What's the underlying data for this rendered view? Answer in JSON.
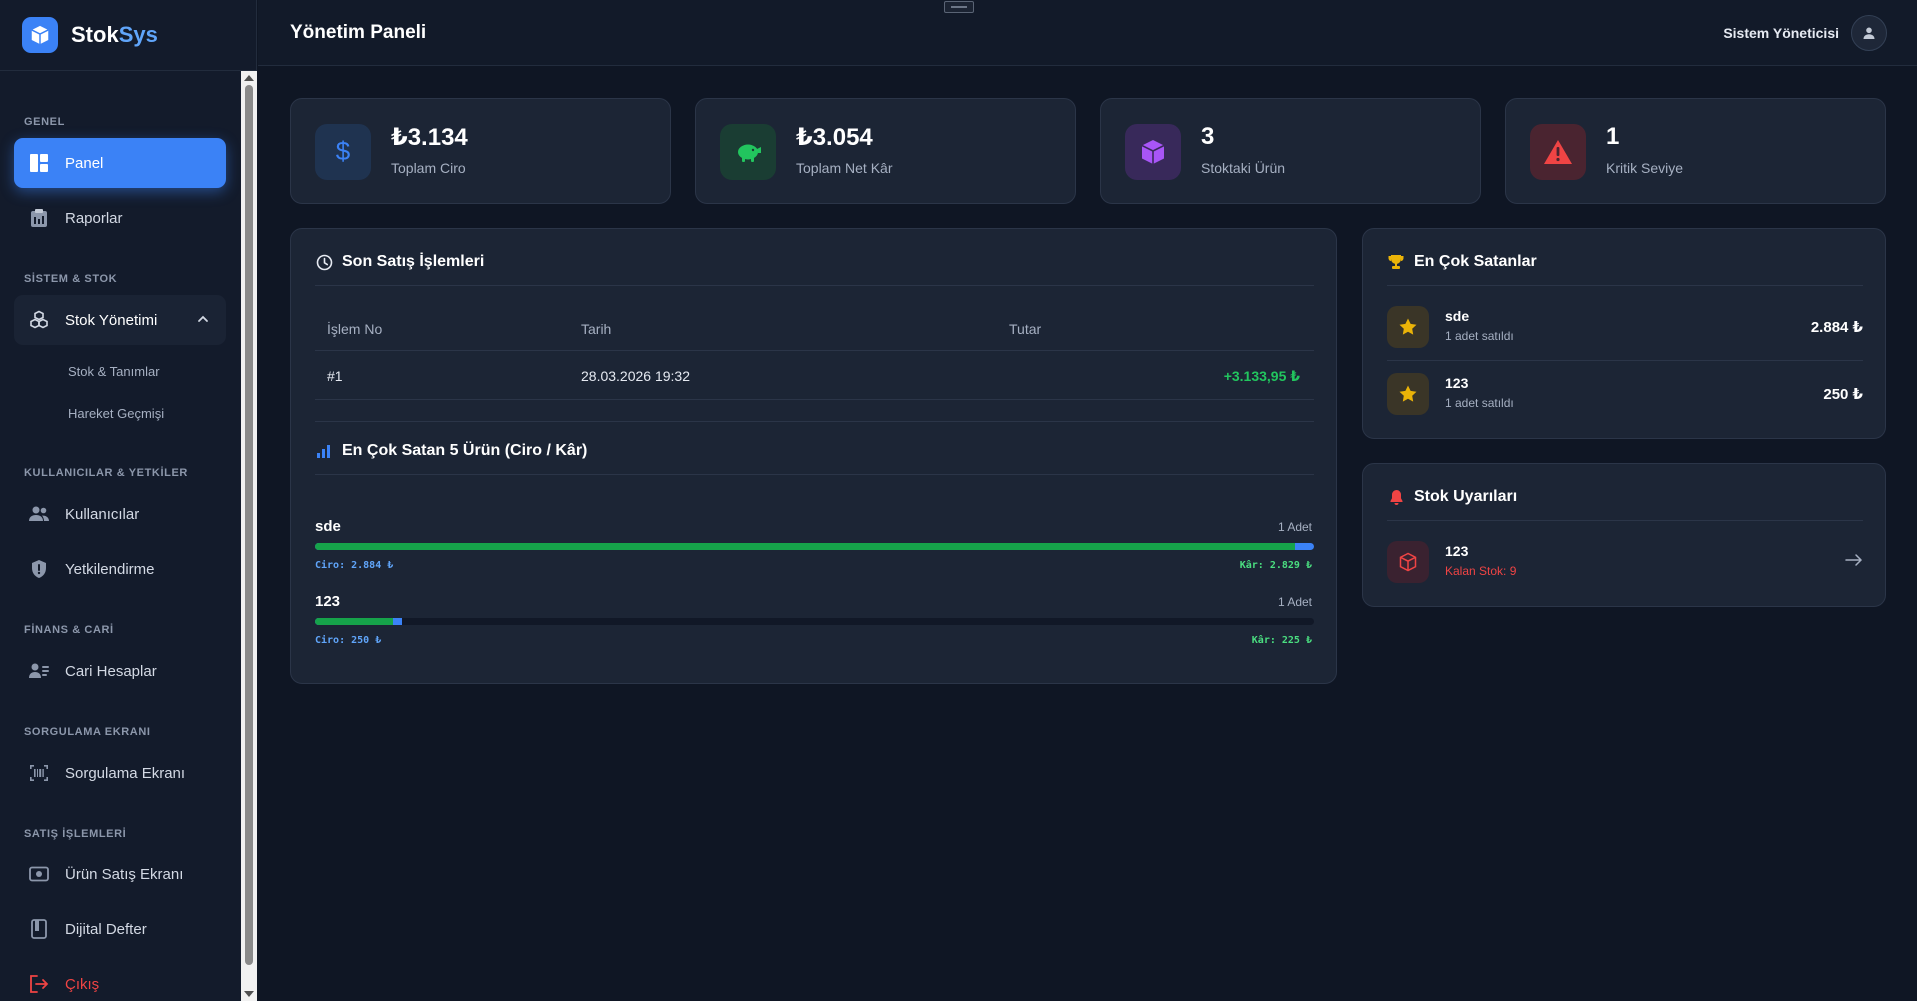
{
  "brand": {
    "name_main": "Stok",
    "name_accent": "Sys",
    "icon": "box-icon"
  },
  "colors": {
    "accent": "#3b82f6",
    "success": "#22c55e",
    "danger": "#ef4444",
    "purple": "#a855f7",
    "warning": "#eab308",
    "background": "#0f1624",
    "card": "#1c2535"
  },
  "sidebar": {
    "sections": {
      "genel": "GENEL",
      "sistem_stok": "SİSTEM & STOK",
      "kullanicilar": "KULLANICILAR & YETKİLER",
      "finans": "FİNANS & CARİ",
      "sorgulama": "SORGULAMA EKRANI",
      "satis": "SATIŞ İŞLEMLERİ"
    },
    "items": {
      "panel": "Panel",
      "raporlar": "Raporlar",
      "stok_yonetimi": "Stok Yönetimi",
      "stok_tanimlar": "Stok & Tanımlar",
      "hareket_gecmisi": "Hareket Geçmişi",
      "kullanicilar": "Kullanıcılar",
      "yetkilendirme": "Yetkilendirme",
      "cari_hesaplar": "Cari Hesaplar",
      "sorgulama_ekrani": "Sorgulama Ekranı",
      "urun_satis_ekrani": "Ürün Satış Ekranı",
      "dijital_defter": "Dijital Defter",
      "cikis": "Çıkış"
    }
  },
  "header": {
    "title": "Yönetim Paneli",
    "user_name": "Sistem Yöneticisi"
  },
  "stats": [
    {
      "value": "₺3.134",
      "label": "Toplam Ciro",
      "icon": "dollar-icon"
    },
    {
      "value": "₺3.054",
      "label": "Toplam Net Kâr",
      "icon": "piggy-bank-icon"
    },
    {
      "value": "3",
      "label": "Stoktaki Ürün",
      "icon": "cube-icon"
    },
    {
      "value": "1",
      "label": "Kritik Seviye",
      "icon": "warning-icon"
    }
  ],
  "recent_sales": {
    "title": "Son Satış İşlemleri",
    "columns": [
      "İşlem No",
      "Tarih",
      "Tutar"
    ],
    "rows": [
      {
        "no": "#1",
        "date": "28.03.2026 19:32",
        "amount": "+3.133,95 ₺"
      }
    ]
  },
  "top_products_chart": {
    "title": "En Çok Satan 5 Ürün (Ciro / Kâr)",
    "items": [
      {
        "name": "sde",
        "qty": "1 Adet",
        "ciro_label": "Ciro: 2.884 ₺",
        "kar_label": "Kâr: 2.829 ₺",
        "ciro": 2884,
        "kar": 2829
      },
      {
        "name": "123",
        "qty": "1 Adet",
        "ciro_label": "Ciro: 250 ₺",
        "kar_label": "Kâr: 225 ₺",
        "ciro": 250,
        "kar": 225
      }
    ]
  },
  "best_sellers": {
    "title": "En Çok Satanlar",
    "items": [
      {
        "name": "sde",
        "sub": "1 adet satıldı",
        "value": "2.884 ₺"
      },
      {
        "name": "123",
        "sub": "1 adet satıldı",
        "value": "250 ₺"
      }
    ]
  },
  "stock_alerts": {
    "title": "Stok Uyarıları",
    "items": [
      {
        "name": "123",
        "sub": "Kalan Stok: 9"
      }
    ]
  }
}
